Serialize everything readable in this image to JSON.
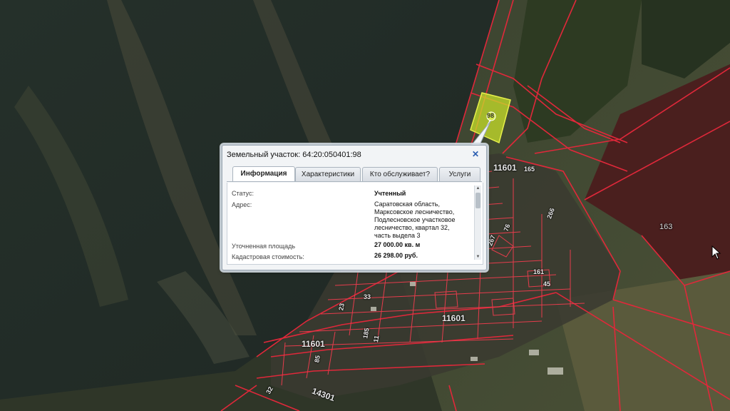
{
  "popup": {
    "title": "Земельный участок: 64:20:050401:98",
    "close_icon": "close-icon",
    "tabs": [
      {
        "label": "Информация",
        "active": true
      },
      {
        "label": "Характеристики",
        "active": false
      },
      {
        "label": "Кто обслуживает?",
        "active": false
      },
      {
        "label": "Услуги",
        "active": false
      }
    ],
    "fields": [
      {
        "label": "Статус:",
        "value": "Учтенный"
      },
      {
        "label": "Адрес:",
        "value": "Саратовская область, Марксовское лесничество, Подлесновское участковое лесничество, квартал 32, часть выдела 3"
      },
      {
        "label": "Уточненная площадь",
        "value": "27 000.00 кв. м"
      },
      {
        "label": "Кадастровая стоимость:",
        "value": "26 298.00 руб."
      }
    ]
  },
  "map": {
    "selected_parcel_label": "98",
    "parcel_labels": {
      "q1": "11601",
      "q2": "11601",
      "q3": "11601",
      "q4": "14301",
      "p163": "163",
      "p165": "165",
      "p266": "266",
      "p76": "76",
      "p267": "267",
      "p33": "33",
      "p23": "23",
      "p161": "161",
      "p45": "45",
      "p85": "85",
      "p32": "32",
      "p185": "185",
      "p11": "11"
    },
    "colors": {
      "boundary": "#e0283a",
      "selected_fill": "#c8e02a",
      "field": "#4a1f1e"
    }
  }
}
